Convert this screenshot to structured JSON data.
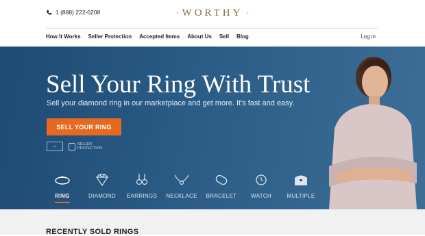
{
  "header": {
    "phone": "1 (888) 222-0208",
    "logo": "WORTHY",
    "nav": [
      "How It Works",
      "Seller Protection",
      "Accepted Items",
      "About Us",
      "Sell",
      "Blog"
    ],
    "login": "Log in"
  },
  "hero": {
    "title": "Sell Your Ring With Trust",
    "subtitle": "Sell your diamond ring in our marketplace and get more. It's fast and easy.",
    "cta": "SELL YOUR RING",
    "badge_seller_line1": "SELLER",
    "badge_seller_line2": "PROTECTION"
  },
  "categories": [
    "RING",
    "DIAMOND",
    "EARRINGS",
    "NECKLACE",
    "BRACELET",
    "WATCH",
    "MULTIPLE"
  ],
  "recent_title": "RECENTLY SOLD RINGS",
  "colors": {
    "accent": "#e56a1f",
    "hero": "#2a5c86",
    "logo": "#8a6a3a"
  }
}
